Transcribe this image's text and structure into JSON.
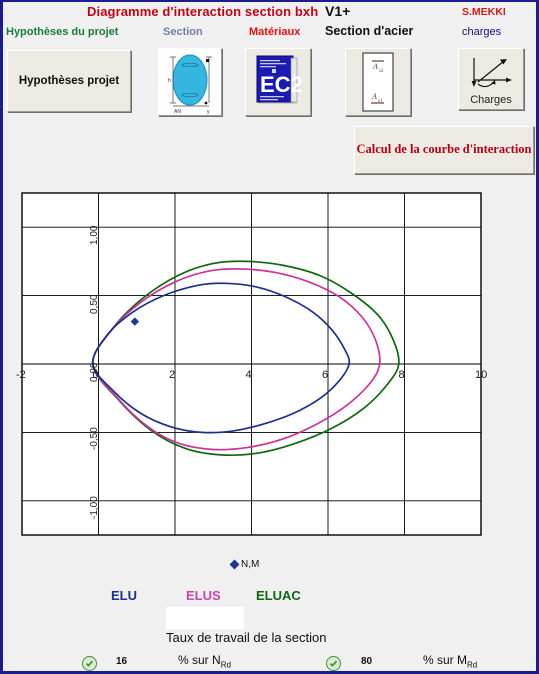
{
  "header": {
    "title": "Diagramme d'interaction section bxh",
    "version": "V1+",
    "author": "S.MEKKI",
    "labels": {
      "hypotheses": "Hypothèses du projet",
      "section": "Section",
      "materiaux": "Matériaux",
      "section_acier": "Section d'acier",
      "charges": "charges"
    }
  },
  "toolbar": {
    "hypotheses_button": "Hypothèses projet",
    "section_button_icon": "ellipse-section-icon",
    "materiaux_button_icon": "ec2-book-icon",
    "materiaux_book_text": "EC2",
    "acier_button_icon": "steel-section-icon",
    "acier_top_label": "As2",
    "acier_bottom_label": "As1",
    "charges_button_icon": "axes-arrows-icon",
    "charges_button_label": "Charges",
    "calcul_button": "Calcul de la courbe d'interaction"
  },
  "chart_data": {
    "type": "line",
    "title": "",
    "xlabel": "",
    "ylabel": "",
    "xlim": [
      -2,
      10
    ],
    "ylim": [
      -1.25,
      1.25
    ],
    "xticks": [
      "-2",
      "0",
      "2",
      "4",
      "6",
      "8",
      "10"
    ],
    "xtick_values": [
      -2,
      0,
      2,
      4,
      6,
      8,
      10
    ],
    "yticks": [
      "1,00",
      "0,50",
      "0,00",
      "-0,50",
      "-1,00"
    ],
    "ytick_values": [
      1.0,
      0.5,
      0.0,
      -0.5,
      -1.0
    ],
    "grid": true,
    "legend_position": "bottom",
    "series": [
      {
        "name": "ELU",
        "color": "#1b2f8c",
        "points": [
          [
            -0.15,
            0.0
          ],
          [
            0.25,
            0.22
          ],
          [
            0.9,
            0.38
          ],
          [
            1.7,
            0.5
          ],
          [
            2.6,
            0.575
          ],
          [
            3.3,
            0.59
          ],
          [
            4.1,
            0.565
          ],
          [
            4.9,
            0.49
          ],
          [
            5.6,
            0.38
          ],
          [
            6.1,
            0.25
          ],
          [
            6.45,
            0.1
          ],
          [
            6.55,
            0.0
          ],
          [
            6.3,
            -0.12
          ],
          [
            5.8,
            -0.25
          ],
          [
            5.1,
            -0.36
          ],
          [
            4.3,
            -0.44
          ],
          [
            3.5,
            -0.49
          ],
          [
            2.7,
            -0.5
          ],
          [
            1.9,
            -0.46
          ],
          [
            1.1,
            -0.36
          ],
          [
            0.4,
            -0.2
          ],
          [
            -0.15,
            0.0
          ]
        ]
      },
      {
        "name": "ELUS",
        "color": "#cc3399",
        "points": [
          [
            -0.15,
            0.0
          ],
          [
            0.35,
            0.25
          ],
          [
            1.1,
            0.45
          ],
          [
            2.0,
            0.6
          ],
          [
            2.9,
            0.68
          ],
          [
            3.7,
            0.695
          ],
          [
            4.6,
            0.67
          ],
          [
            5.5,
            0.6
          ],
          [
            6.3,
            0.49
          ],
          [
            6.9,
            0.34
          ],
          [
            7.25,
            0.17
          ],
          [
            7.35,
            0.0
          ],
          [
            7.1,
            -0.14
          ],
          [
            6.5,
            -0.3
          ],
          [
            5.7,
            -0.44
          ],
          [
            4.8,
            -0.55
          ],
          [
            3.9,
            -0.61
          ],
          [
            3.0,
            -0.625
          ],
          [
            2.1,
            -0.58
          ],
          [
            1.3,
            -0.46
          ],
          [
            0.5,
            -0.25
          ],
          [
            -0.15,
            0.0
          ]
        ]
      },
      {
        "name": "ELUAC",
        "color": "#116611",
        "points": [
          [
            -0.15,
            0.0
          ],
          [
            0.4,
            0.27
          ],
          [
            1.2,
            0.49
          ],
          [
            2.1,
            0.65
          ],
          [
            3.0,
            0.735
          ],
          [
            3.9,
            0.75
          ],
          [
            4.85,
            0.72
          ],
          [
            5.8,
            0.645
          ],
          [
            6.6,
            0.52
          ],
          [
            7.3,
            0.36
          ],
          [
            7.7,
            0.18
          ],
          [
            7.85,
            0.0
          ],
          [
            7.55,
            -0.15
          ],
          [
            6.95,
            -0.32
          ],
          [
            6.1,
            -0.47
          ],
          [
            5.15,
            -0.58
          ],
          [
            4.2,
            -0.65
          ],
          [
            3.25,
            -0.665
          ],
          [
            2.3,
            -0.62
          ],
          [
            1.4,
            -0.49
          ],
          [
            0.55,
            -0.27
          ],
          [
            -0.15,
            0.0
          ]
        ]
      }
    ],
    "marker_point": {
      "name": "N,M",
      "x": 0.95,
      "y": 0.31,
      "color": "#1b3a8c",
      "shape": "diamond"
    }
  },
  "legend": {
    "point_label": "N,M",
    "elu": "ELU",
    "elus": "ELUS",
    "eluac": "ELUAC"
  },
  "footer": {
    "taux_label": "Taux de travail de la section",
    "stats": [
      {
        "icon": "check-ok-icon",
        "value": "16",
        "label_prefix": "% sur N",
        "label_sub": "Rd"
      },
      {
        "icon": "check-ok-icon",
        "value": "80",
        "label_prefix": "% sur M",
        "label_sub": "Rd"
      }
    ]
  }
}
